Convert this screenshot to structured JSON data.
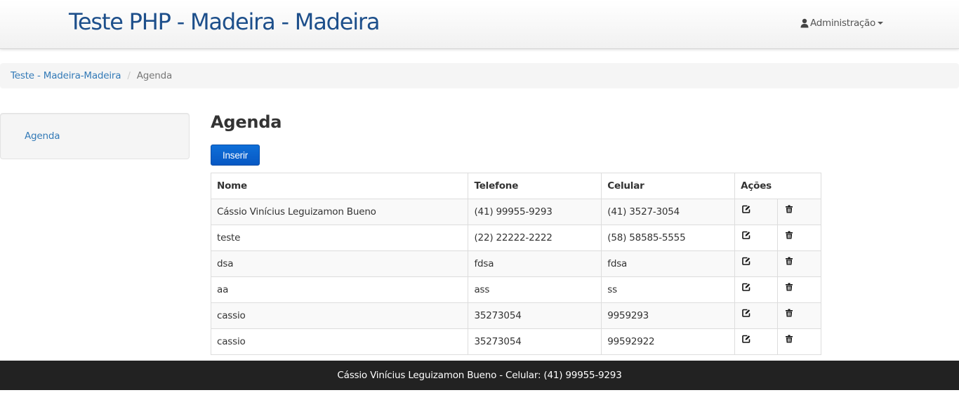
{
  "navbar": {
    "brand": "Teste PHP - Madeira - Madeira",
    "admin_label": "Administração",
    "user_icon": "user-icon",
    "caret_icon": "caret-down-icon"
  },
  "breadcrumb": {
    "home": "Teste - Madeira-Madeira",
    "separator": "/",
    "current": "Agenda"
  },
  "sidebar": {
    "items": [
      {
        "label": "Agenda"
      }
    ]
  },
  "main": {
    "title": "Agenda",
    "insert_label": "Inserir",
    "columns": [
      "Nome",
      "Telefone",
      "Celular",
      "Ações"
    ],
    "rows": [
      {
        "nome": "Cássio Vinícius Leguizamon Bueno",
        "telefone": "(41) 99955-9293",
        "celular": "(41) 3527-3054"
      },
      {
        "nome": "teste",
        "telefone": "(22) 22222-2222",
        "celular": "(58) 58585-5555"
      },
      {
        "nome": "dsa",
        "telefone": "fdsa",
        "celular": "fdsa"
      },
      {
        "nome": "aa",
        "telefone": "ass",
        "celular": "ss"
      },
      {
        "nome": "cassio",
        "telefone": "35273054",
        "celular": "9959293"
      },
      {
        "nome": "cassio",
        "telefone": "35273054",
        "celular": "99592922"
      }
    ],
    "edit_icon": "edit-icon",
    "delete_icon": "trash-icon"
  },
  "footer": {
    "text": "Cássio Vinícius Leguizamon Bueno - Celular: (41) 99955-9293"
  },
  "colors": {
    "brand": "#1d4f8b",
    "link": "#337ab7",
    "primary_button": "#0758c4",
    "footer_bg": "#222222"
  }
}
